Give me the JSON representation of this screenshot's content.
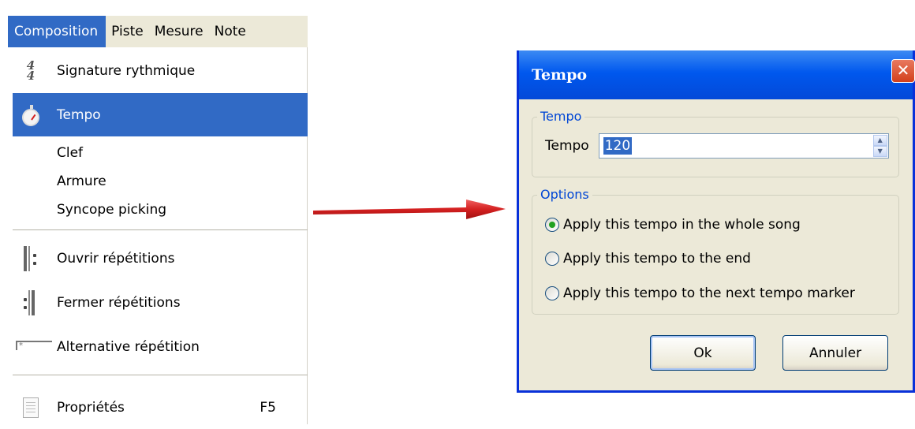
{
  "menubar": {
    "items": [
      "Composition",
      "Piste",
      "Mesure",
      "Note"
    ]
  },
  "menu": {
    "time_signature_icon": {
      "top": "4",
      "bottom": "4"
    },
    "items": [
      {
        "label": "Signature rythmique",
        "icon": "time-signature-icon"
      },
      {
        "label": "Tempo",
        "icon": "stopwatch-icon",
        "selected": true
      },
      {
        "label": "Clef"
      },
      {
        "label": "Armure"
      },
      {
        "label": "Syncope picking"
      },
      {
        "label": "Ouvrir répétitions",
        "icon": "open-repeat-icon"
      },
      {
        "label": "Fermer répétitions",
        "icon": "close-repeat-icon"
      },
      {
        "label": "Alternative répétition",
        "icon": "alternative-ending-icon",
        "icon_text": "*"
      },
      {
        "label": "Propriétés",
        "shortcut": "F5",
        "icon": "properties-icon"
      }
    ]
  },
  "dialog": {
    "title": "Tempo",
    "close_glyph": "✕",
    "tempo_group": {
      "legend": "Tempo",
      "field_label": "Tempo",
      "value": "120"
    },
    "options_group": {
      "legend": "Options",
      "options": [
        {
          "label": "Apply this tempo in the whole song",
          "checked": true
        },
        {
          "label": "Apply this tempo to the end",
          "checked": false
        },
        {
          "label": "Apply this tempo to the next tempo marker",
          "checked": false
        }
      ]
    },
    "ok_label": "Ok",
    "cancel_label": "Annuler"
  },
  "colors": {
    "menu_highlight": "#316ac5",
    "dialog_title": "#0058ee",
    "arrow": "#d42020",
    "group_legend": "#0046d5"
  }
}
